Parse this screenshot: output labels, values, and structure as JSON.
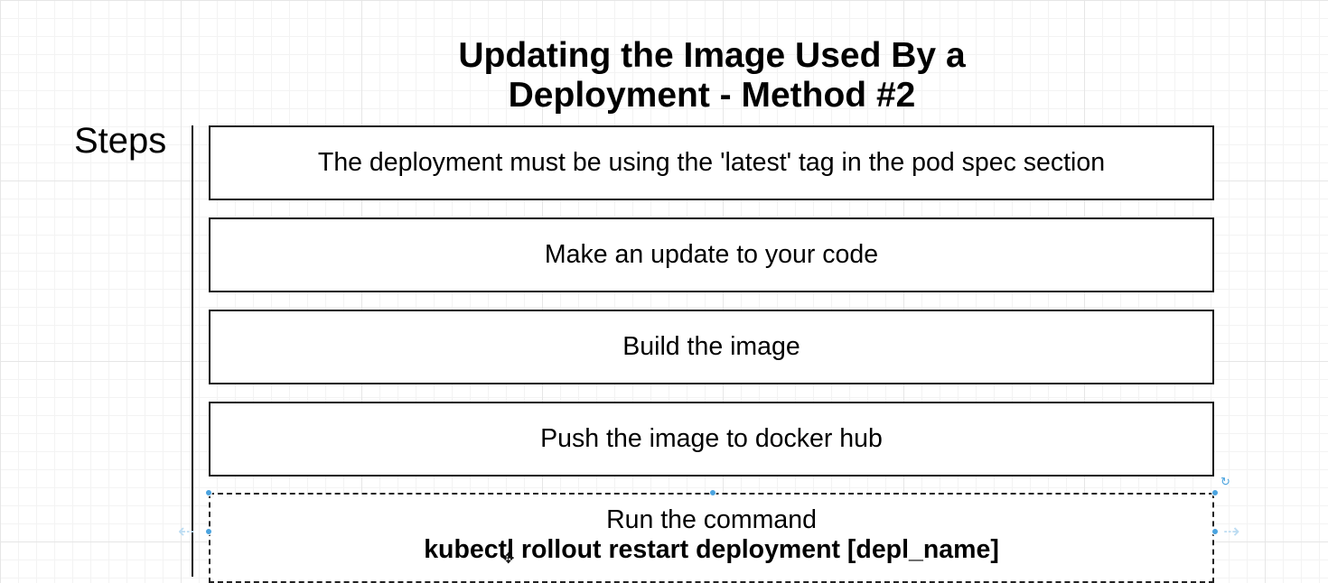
{
  "title": {
    "line1": "Updating the Image Used By a",
    "line2": "Deployment - Method #2"
  },
  "steps_label": "Steps",
  "steps": [
    {
      "text": "The deployment must be using the 'latest' tag in the pod spec section"
    },
    {
      "text": "Make an update to your code"
    },
    {
      "text": "Build the image"
    },
    {
      "text": "Push the image to docker hub"
    },
    {
      "text": "Run the command",
      "command": "kubectl rollout restart deployment [depl_name]"
    }
  ],
  "colors": {
    "selection_handle": "#4aa3df",
    "box_border": "#111111",
    "grid": "#e6e6e6"
  }
}
